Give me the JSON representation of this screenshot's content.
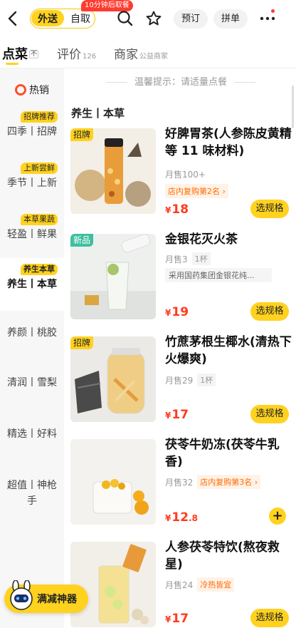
{
  "header": {
    "mode_active": "外送",
    "mode_inactive": "自取",
    "promo_badge": "10分钟后取餐",
    "btn_reserve": "预订",
    "btn_group": "拼单"
  },
  "tabs": [
    {
      "label": "点菜",
      "sub": "",
      "badge": "不"
    },
    {
      "label": "评价",
      "sub": "126"
    },
    {
      "label": "商家",
      "sub": "公益商家"
    }
  ],
  "sidebar": {
    "hot": "热销",
    "categories": [
      {
        "tag": "招牌推荐",
        "label": "四季丨招牌"
      },
      {
        "tag": "上新尝鲜",
        "label": "季节丨上新"
      },
      {
        "tag": "本草果蔬",
        "label": "轻盈丨鲜果"
      },
      {
        "tag": "养生本草",
        "label": "养生丨本草"
      },
      {
        "tag": "",
        "label": "养颜丨桃胶"
      },
      {
        "tag": "",
        "label": "清润丨雪梨"
      },
      {
        "tag": "",
        "label": "精选丨好料"
      },
      {
        "tag": "",
        "label": "超值丨神枪手"
      }
    ]
  },
  "list": {
    "tip": "温馨提示：请适量点餐",
    "section": "养生丨本草",
    "items": [
      {
        "badge": "招牌",
        "name": "好脾胃茶(人参陈皮黄精等 11 味材料)",
        "sold": "月售100+",
        "chip": "",
        "rank": "店内复购第2名",
        "desc": "",
        "price_int": "18",
        "price_dec": "",
        "action": "选规格"
      },
      {
        "badge": "新品",
        "name": "金银花灭火茶",
        "sold": "月售3",
        "chip": "1杯",
        "rank": "",
        "desc": "采用国药集团金银花纯...",
        "price_int": "19",
        "price_dec": "",
        "action": "选规格"
      },
      {
        "badge": "招牌",
        "name": "竹蔗茅根生椰水(清热下火爆爽)",
        "sold": "月售29",
        "chip": "1杯",
        "rank": "",
        "desc": "",
        "price_int": "17",
        "price_dec": "",
        "action": "选规格"
      },
      {
        "badge": "",
        "name": "茯苓牛奶冻(茯苓牛乳香)",
        "sold": "月售32",
        "chip": "",
        "rank": "店内复购第3名",
        "desc": "",
        "price_int": "12",
        "price_dec": ".8",
        "action": "+"
      },
      {
        "badge": "",
        "name": "人参茯苓特饮(熬夜救星)",
        "sold": "月售24",
        "chip": "",
        "rank": "冷热皆宜",
        "desc": "",
        "price_int": "17",
        "price_dec": "",
        "action": "选规格"
      }
    ]
  },
  "float_button": "满减神器",
  "colors": {
    "accent": "#ffd21f",
    "price": "#ff3b1f",
    "new_badge": "#3dbfa0"
  }
}
